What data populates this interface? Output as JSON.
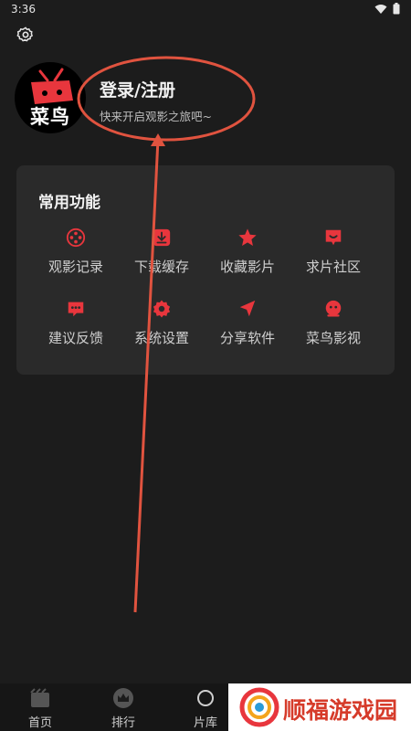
{
  "status_bar": {
    "time": "3:36"
  },
  "profile": {
    "avatar_text": "菜鸟",
    "login_title": "登录/注册",
    "login_subtitle": "快来开启观影之旅吧~"
  },
  "features": {
    "title": "常用功能",
    "items": [
      {
        "label": "观影记录",
        "icon": "film-reel-icon"
      },
      {
        "label": "下载缓存",
        "icon": "download-icon"
      },
      {
        "label": "收藏影片",
        "icon": "star-icon"
      },
      {
        "label": "求片社区",
        "icon": "chat-bubble-icon"
      },
      {
        "label": "建议反馈",
        "icon": "feedback-icon"
      },
      {
        "label": "系统设置",
        "icon": "settings-icon"
      },
      {
        "label": "分享软件",
        "icon": "share-icon"
      },
      {
        "label": "菜鸟影视",
        "icon": "app-logo-icon"
      }
    ]
  },
  "bottom_nav": {
    "items": [
      {
        "label": "首页",
        "icon": "home-icon"
      },
      {
        "label": "排行",
        "icon": "crown-icon"
      },
      {
        "label": "片库",
        "icon": "library-icon"
      }
    ]
  },
  "watermark": {
    "text": "顺福游戏园"
  },
  "colors": {
    "accent": "#e8363d",
    "annotation": "#e0533f",
    "background": "#1c1c1c",
    "card": "#2a2a2a"
  }
}
